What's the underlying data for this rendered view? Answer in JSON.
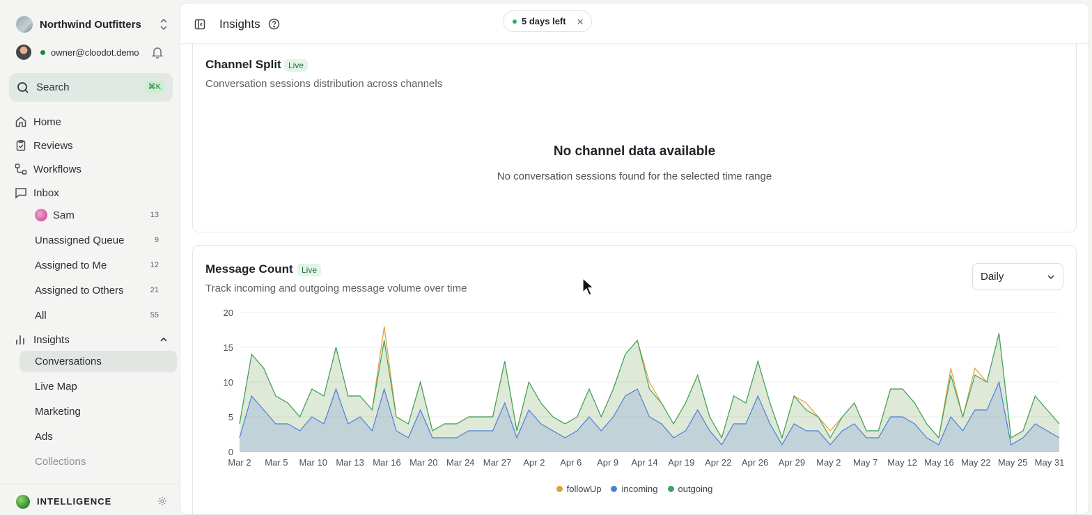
{
  "org": {
    "name": "Northwind Outfitters"
  },
  "user": {
    "email": "owner@cloodot.demo"
  },
  "search": {
    "label": "Search",
    "shortcut": "⌘K"
  },
  "nav": {
    "home": "Home",
    "reviews": "Reviews",
    "workflows": "Workflows",
    "inbox": "Inbox",
    "inbox_items": [
      {
        "label": "Sam",
        "count": "13"
      },
      {
        "label": "Unassigned Queue",
        "count": "9"
      },
      {
        "label": "Assigned to Me",
        "count": "12"
      },
      {
        "label": "Assigned to Others",
        "count": "21"
      },
      {
        "label": "All",
        "count": "55"
      }
    ],
    "insights": "Insights",
    "insights_items": [
      "Conversations",
      "Live Map",
      "Marketing",
      "Ads",
      "Collections"
    ]
  },
  "brand": {
    "label": "INTELLIGENCE"
  },
  "header": {
    "title": "Insights",
    "trial": "5 days left",
    "trial_close": "✕"
  },
  "channel_split": {
    "title": "Channel Split",
    "badge": "Live",
    "subtitle": "Conversation sessions distribution across channels",
    "empty_title": "No channel data available",
    "empty_subtitle": "No conversation sessions found for the selected time range"
  },
  "message_count": {
    "title": "Message Count",
    "badge": "Live",
    "subtitle": "Track incoming and outgoing message volume over time",
    "interval": "Daily"
  },
  "colors": {
    "followUp": "#e0a03a",
    "incoming": "#4a7fdc",
    "outgoing": "#3aa565",
    "accent": "#2fae5a"
  },
  "chart_data": {
    "type": "area",
    "ylim": [
      0,
      20
    ],
    "yticks": [
      0,
      5,
      10,
      15,
      20
    ],
    "xtick_labels": [
      "Mar 2",
      "Mar 5",
      "Mar 10",
      "Mar 13",
      "Mar 16",
      "Mar 20",
      "Mar 24",
      "Mar 27",
      "Apr 2",
      "Apr 6",
      "Apr 9",
      "Apr 14",
      "Apr 19",
      "Apr 22",
      "Apr 26",
      "Apr 29",
      "May 2",
      "May 7",
      "May 12",
      "May 16",
      "May 22",
      "May 25",
      "May 31"
    ],
    "legend": "bottom-center",
    "series": [
      {
        "name": "followUp",
        "values": [
          4,
          14,
          12,
          8,
          7,
          5,
          9,
          8,
          15,
          8,
          8,
          6,
          18,
          5,
          4,
          10,
          3,
          4,
          4,
          5,
          5,
          5,
          13,
          3,
          10,
          7,
          5,
          4,
          5,
          9,
          5,
          9,
          14,
          16,
          10,
          7,
          4,
          7,
          11,
          5,
          2,
          8,
          7,
          13,
          7,
          2,
          8,
          7,
          5,
          3,
          5,
          7,
          3,
          3,
          9,
          9,
          7,
          4,
          2,
          12,
          5,
          12,
          10,
          17,
          2,
          3,
          8,
          6,
          4
        ]
      },
      {
        "name": "outgoing",
        "values": [
          4,
          14,
          12,
          8,
          7,
          5,
          9,
          8,
          15,
          8,
          8,
          6,
          16,
          5,
          4,
          10,
          3,
          4,
          4,
          5,
          5,
          5,
          13,
          3,
          10,
          7,
          5,
          4,
          5,
          9,
          5,
          9,
          14,
          16,
          9,
          7,
          4,
          7,
          11,
          5,
          2,
          8,
          7,
          13,
          7,
          2,
          8,
          6,
          5,
          2,
          5,
          7,
          3,
          3,
          9,
          9,
          7,
          4,
          2,
          11,
          5,
          11,
          10,
          17,
          2,
          3,
          8,
          6,
          4
        ]
      },
      {
        "name": "incoming",
        "values": [
          2,
          8,
          6,
          4,
          4,
          3,
          5,
          4,
          9,
          4,
          5,
          3,
          9,
          3,
          2,
          6,
          2,
          2,
          2,
          3,
          3,
          3,
          7,
          2,
          6,
          4,
          3,
          2,
          3,
          5,
          3,
          5,
          8,
          9,
          5,
          4,
          2,
          3,
          6,
          3,
          1,
          4,
          4,
          8,
          4,
          1,
          4,
          3,
          3,
          1,
          3,
          4,
          2,
          2,
          5,
          5,
          4,
          2,
          1,
          5,
          3,
          6,
          6,
          10,
          1,
          2,
          4,
          3,
          2
        ]
      }
    ]
  }
}
